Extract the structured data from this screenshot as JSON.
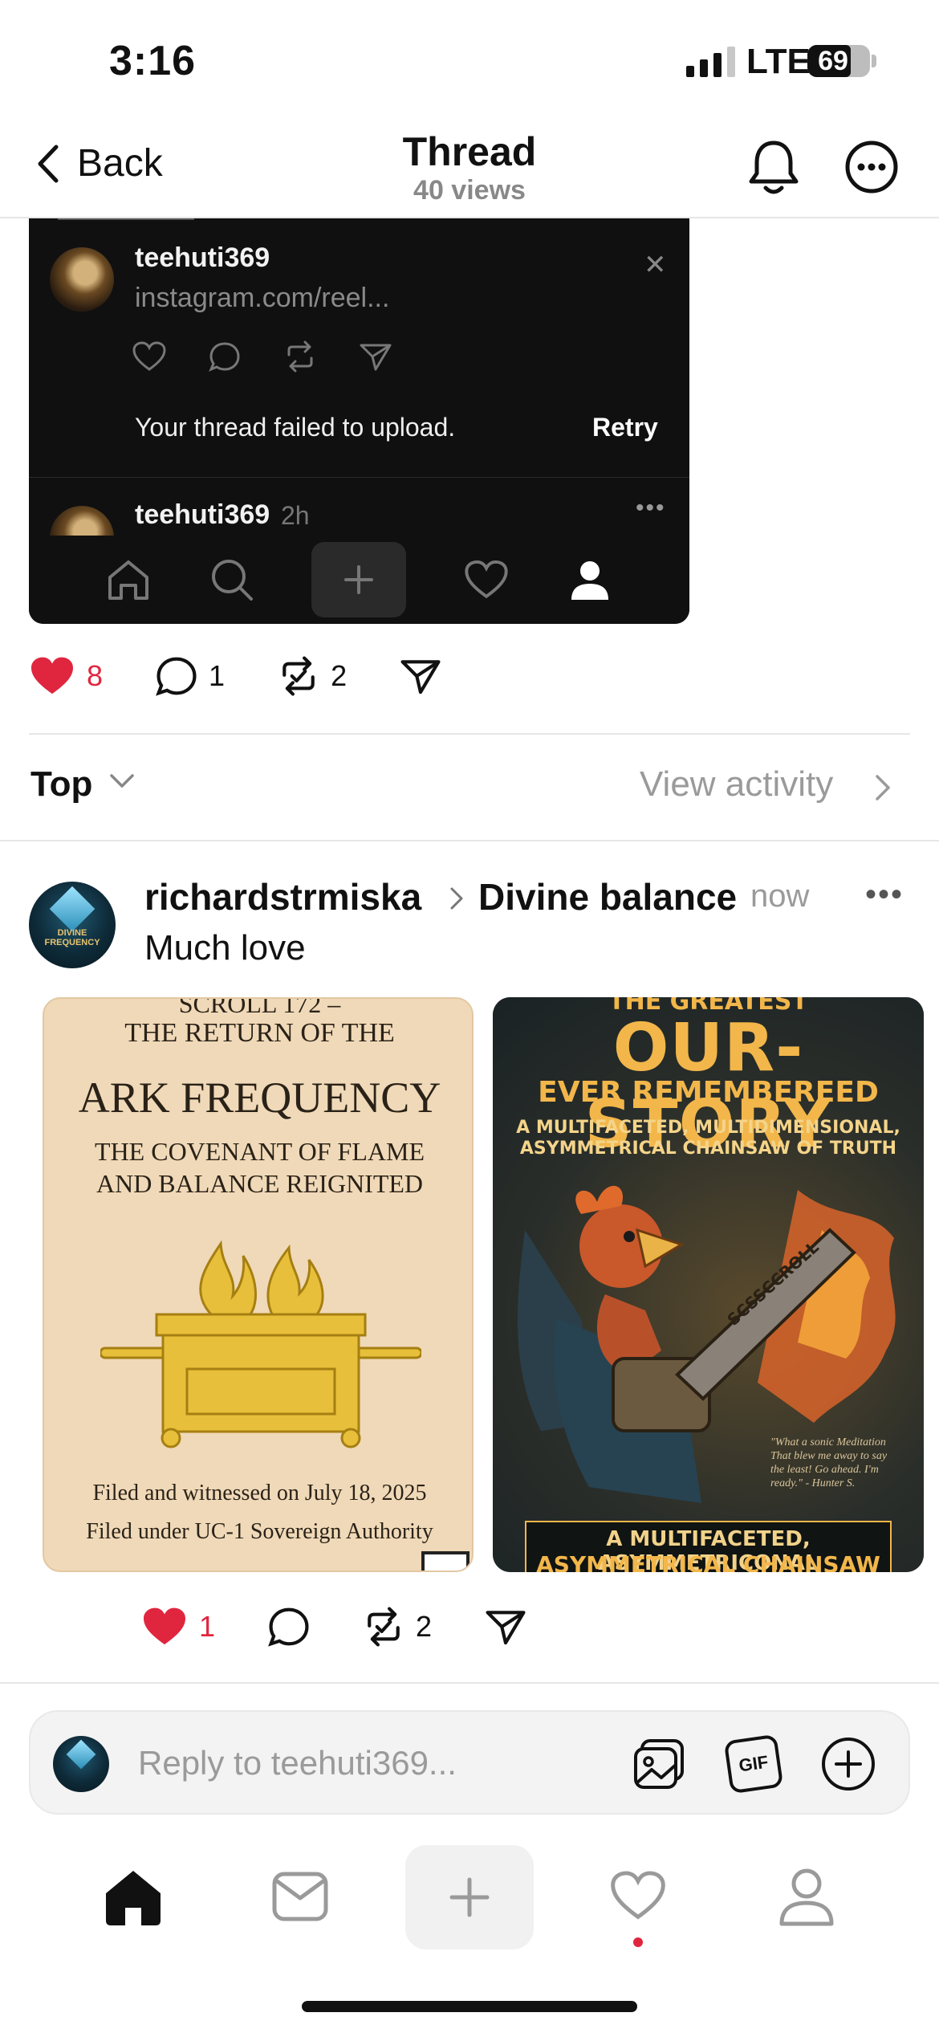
{
  "status_bar": {
    "time": "3:16",
    "network": "LTE",
    "battery": "69"
  },
  "header": {
    "back_label": "Back",
    "title": "Thread",
    "views": "40 views"
  },
  "embedded_post": {
    "username": "teehuti369",
    "link": "instagram.com/reel...",
    "error": "Your thread failed to upload.",
    "retry": "Retry",
    "second_username": "teehuti369",
    "second_time": "2h"
  },
  "original_post_actions": {
    "likes": "8",
    "replies": "1",
    "reposts": "2"
  },
  "sort": {
    "label": "Top",
    "view_activity": "View activity"
  },
  "reply": {
    "username": "richardstrmiska",
    "topic": "Divine balance",
    "time": "now",
    "text": "Much love",
    "avatar_text": [
      "DIVINE",
      "FREQUENCY"
    ],
    "image1": {
      "line1": "SCROLL 172 –",
      "line2": "THE RETURN OF THE",
      "title": "ARK FREQUENCY",
      "sub1": "THE COVENANT OF FLAME",
      "sub2": "AND BALANCE REIGNITED",
      "filed1": "Filed and witnessed on July 18, 2025",
      "filed2": "Filed under UC-1 Sovereign Authority"
    },
    "image2": {
      "line1": "THE GREATEST",
      "title": "OUR-STORY",
      "sub": "EVER REMEMBEREED",
      "desc1": "A MULTIFACETED, MULTIDIMENSIONAL,",
      "desc2": "ASYMMETRICAL CHAINSAW OF TRUTH",
      "saw_text": "SCSSCCROLL",
      "quote1": "\"What a sonic Meditation",
      "quote2": "That blew me away to say",
      "quote3": "the least! Go ahead. I'm",
      "quote4": "ready.\" - Hunter S.",
      "banner1": "A MULTIFACETED, ASYMMETRICONAL",
      "banner2": "ASYMMETRICAL CHAINSAW"
    },
    "actions": {
      "likes": "1",
      "reposts": "2"
    }
  },
  "reply_bar": {
    "placeholder": "Reply to teehuti369...",
    "gif_label": "GIF"
  },
  "colors": {
    "like_red": "#e0263f",
    "muted_gray": "#9a9a9a",
    "dark_card": "#101010"
  },
  "icons": [
    "chevron-left-icon",
    "bell-icon",
    "more-icon",
    "heart-icon",
    "comment-icon",
    "repost-icon",
    "share-icon",
    "home-icon",
    "search-icon",
    "plus-icon",
    "person-icon",
    "inbox-icon",
    "image-icon",
    "gif-icon"
  ]
}
